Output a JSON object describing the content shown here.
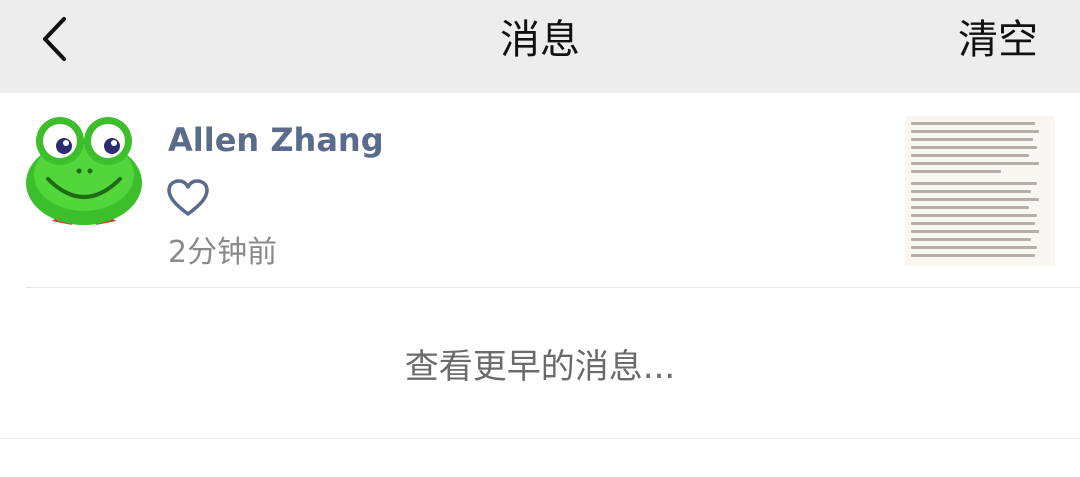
{
  "nav": {
    "title": "消息",
    "back_icon": "chevron-left-icon",
    "clear_label": "清空"
  },
  "message": {
    "sender": "Allen Zhang",
    "reaction_icon": "heart-outline-icon",
    "time": "2分钟前",
    "avatar": "frog-avatar",
    "thumbnail": "article-text-thumbnail"
  },
  "more": {
    "label": "查看更早的消息..."
  },
  "colors": {
    "nav_bg": "#ededed",
    "sender_name": "#5b6b8c",
    "secondary_text": "#8a8a8a"
  }
}
